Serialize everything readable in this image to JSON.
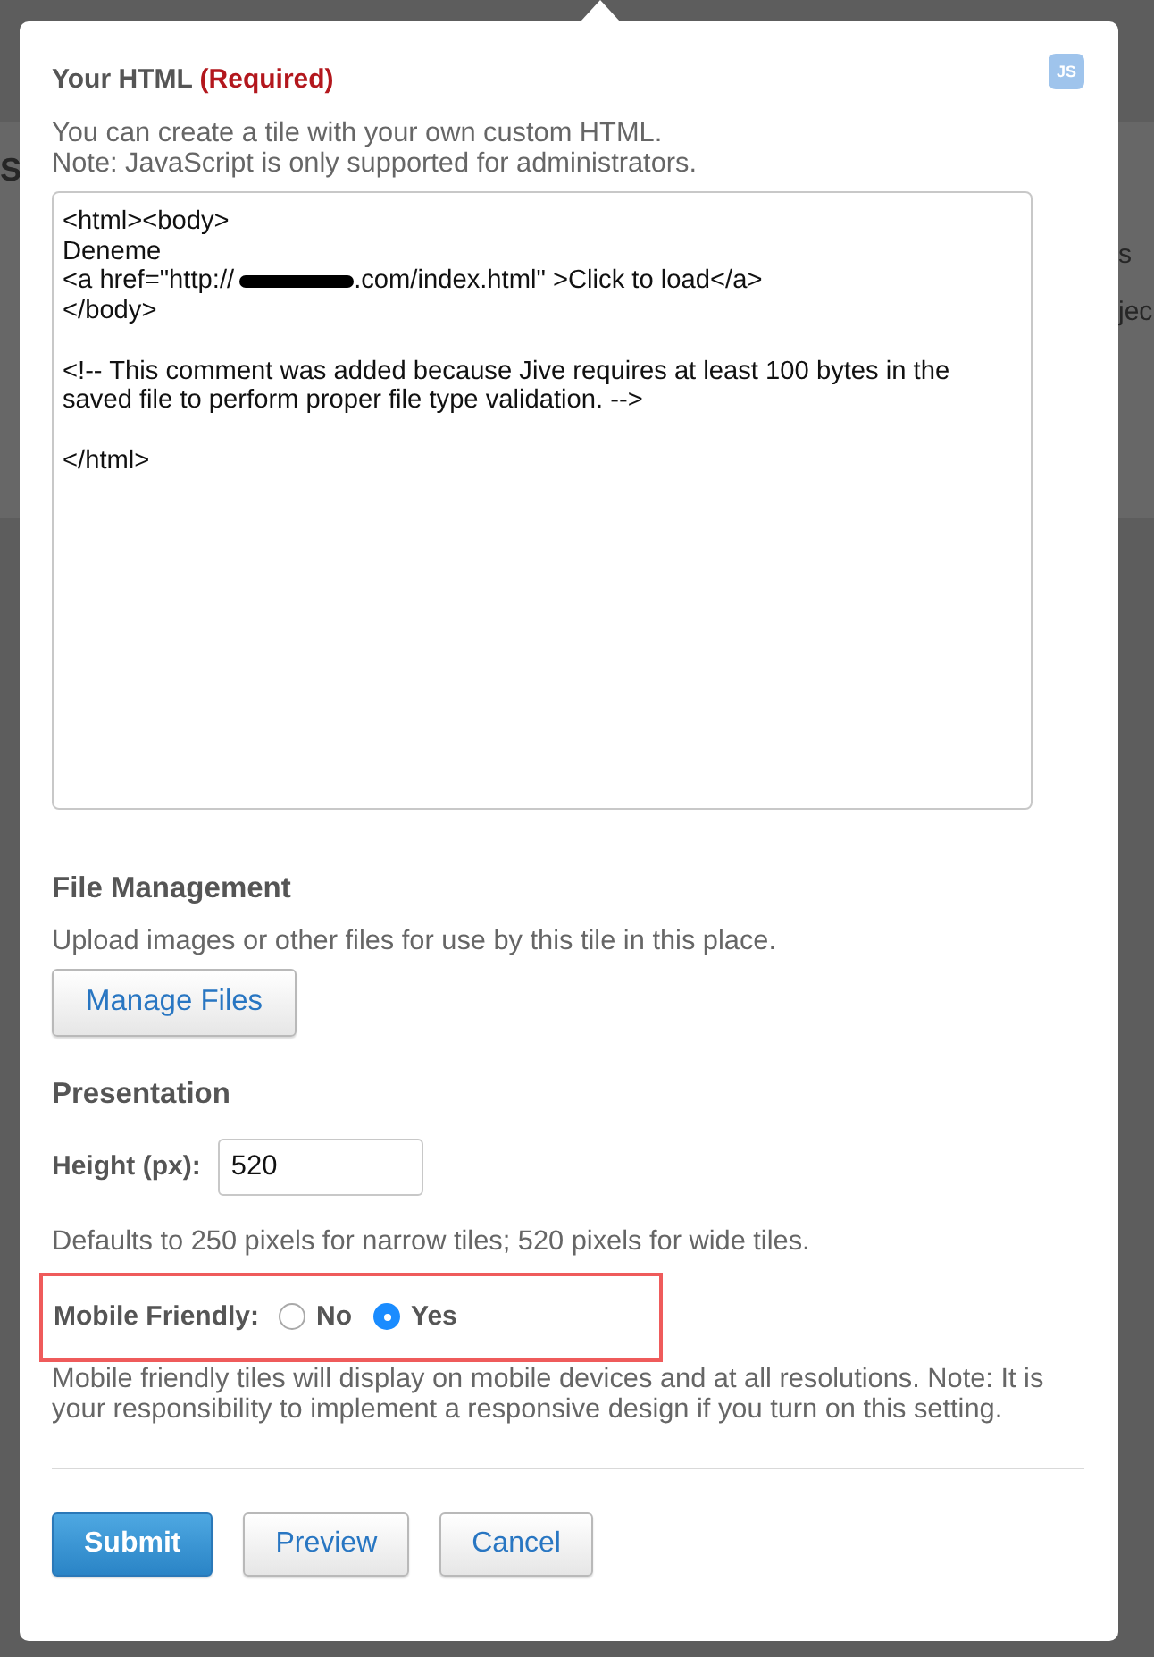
{
  "background_page": {
    "left": [
      "S"
    ],
    "right": [
      "s",
      "jec"
    ]
  },
  "dialog": {
    "badge": "JS",
    "html_section": {
      "title": "Your HTML",
      "required_note": "(Required)",
      "description": [
        "You can create a tile with your own custom HTML.",
        "Note: JavaScript is only supported for administrators."
      ],
      "editor_lines": [
        {
          "kind": "text",
          "text": "<html><body>"
        },
        {
          "kind": "text",
          "text": "Deneme"
        },
        {
          "kind": "redacted",
          "before": "<a href=\"http://",
          "after": ".com/index.html\" >Click to load</a>"
        },
        {
          "kind": "text",
          "text": "</body>"
        },
        {
          "kind": "blank"
        },
        {
          "kind": "text",
          "text": "<!-- This comment was added because Jive requires at least 100 bytes in the saved file to perform proper file type validation. -->"
        },
        {
          "kind": "blank"
        },
        {
          "kind": "text",
          "text": "</html>"
        }
      ]
    },
    "file_management": {
      "title": "File Management",
      "description": "Upload images or other files for use by this tile in this place.",
      "button": "Manage Files"
    },
    "presentation": {
      "title": "Presentation",
      "height_label": "Height (px):",
      "height_value": "520",
      "height_hint": "Defaults to 250 pixels for narrow tiles; 520 pixels for wide tiles.",
      "mobile_friendly": {
        "label": "Mobile Friendly:",
        "options": [
          {
            "label": "No",
            "selected": false
          },
          {
            "label": "Yes",
            "selected": true
          }
        ]
      },
      "mobile_note": "Mobile friendly tiles will display on mobile devices and at all resolutions. Note: It is your responsibility to implement a responsive design if you turn on this setting."
    },
    "buttons": [
      {
        "label": "Submit",
        "kind": "primary"
      },
      {
        "label": "Preview",
        "kind": "secondary"
      },
      {
        "label": "Cancel",
        "kind": "secondary"
      }
    ]
  }
}
